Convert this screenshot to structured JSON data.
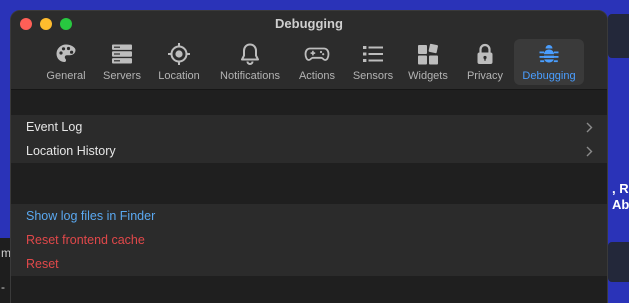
{
  "window": {
    "title": "Debugging"
  },
  "toolbar": {
    "items": [
      {
        "label": "General",
        "icon": "palette-icon"
      },
      {
        "label": "Servers",
        "icon": "server-icon"
      },
      {
        "label": "Location",
        "icon": "location-crosshair-icon"
      },
      {
        "label": "Notifications",
        "icon": "bell-icon"
      },
      {
        "label": "Actions",
        "icon": "gamepad-icon"
      },
      {
        "label": "Sensors",
        "icon": "list-icon"
      },
      {
        "label": "Widgets",
        "icon": "widgets-icon"
      },
      {
        "label": "Privacy",
        "icon": "lock-icon"
      },
      {
        "label": "Debugging",
        "icon": "bug-icon",
        "active": true
      }
    ]
  },
  "groups": {
    "logs": [
      {
        "label": "Event Log"
      },
      {
        "label": "Location History"
      }
    ],
    "actions": [
      {
        "label": "Show log files in Finder"
      },
      {
        "label": "Reset frontend cache"
      },
      {
        "label": "Reset"
      }
    ]
  },
  "background": {
    "right_text": ", Ri\nAb",
    "left_text_top": "m",
    "left_text_bottom": "-"
  },
  "colors": {
    "accent": "#4a9eff",
    "link": "#5aa8f0",
    "danger": "#e0484a",
    "desktop": "#2a33b8"
  }
}
